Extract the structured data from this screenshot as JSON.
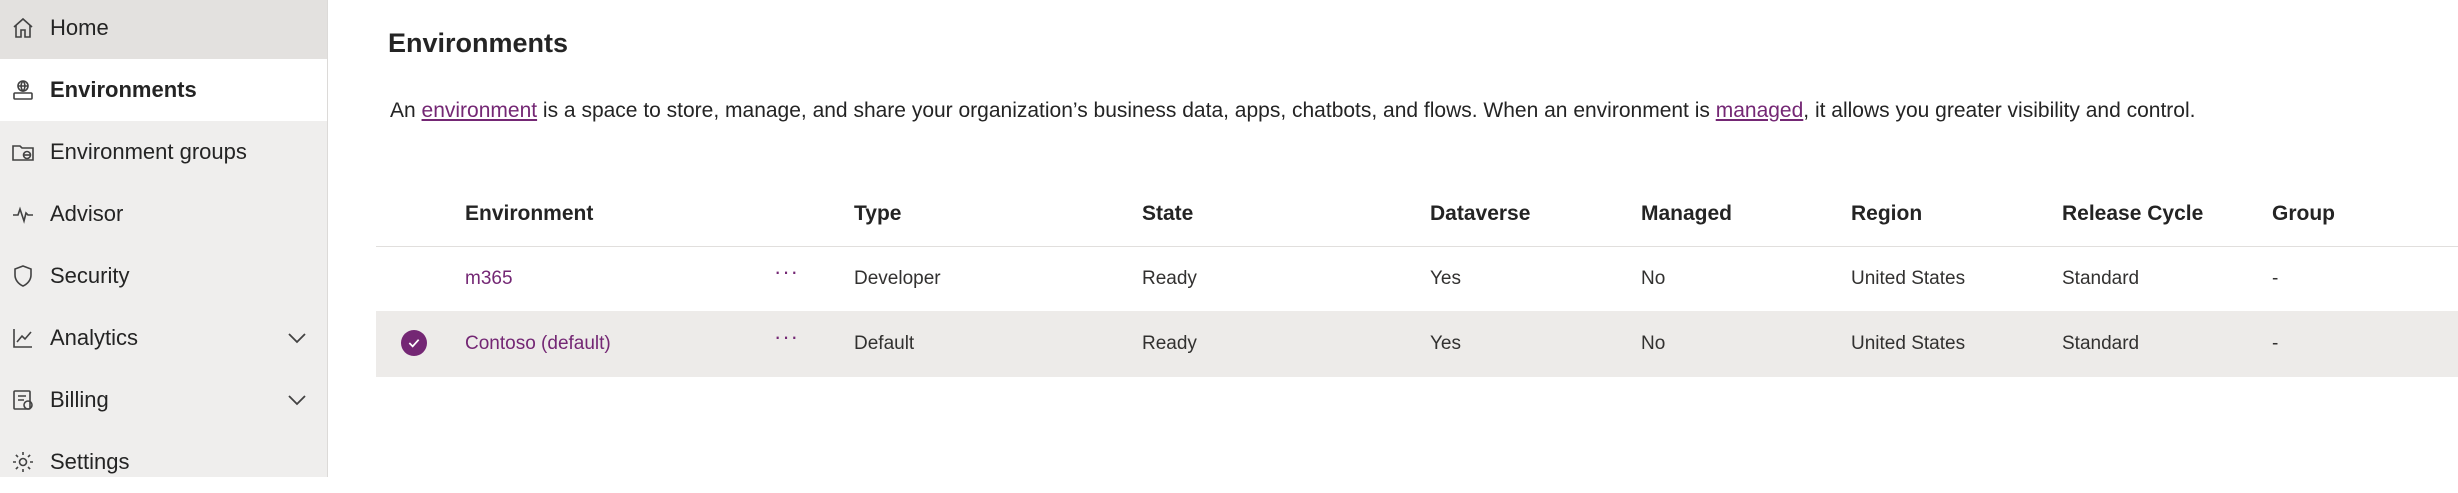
{
  "sidebar": {
    "items": [
      {
        "label": "Home",
        "icon": "home-icon"
      },
      {
        "label": "Environments",
        "icon": "environments-icon"
      },
      {
        "label": "Environment groups",
        "icon": "environment-groups-icon"
      },
      {
        "label": "Advisor",
        "icon": "pulse-icon"
      },
      {
        "label": "Security",
        "icon": "shield-icon"
      },
      {
        "label": "Analytics",
        "icon": "chart-icon"
      },
      {
        "label": "Billing",
        "icon": "billing-icon"
      },
      {
        "label": "Settings",
        "icon": "gear-icon"
      }
    ]
  },
  "main": {
    "title": "Environments",
    "description": {
      "part1": "An ",
      "link1": "environment",
      "part2": " is a space to store, manage, and share your organization’s business data, apps, chatbots, and flows. When an environment is ",
      "link2": "managed",
      "part3": ", it allows you greater visibility and control."
    }
  },
  "table": {
    "columns": [
      "Environment",
      "Type",
      "State",
      "Dataverse",
      "Managed",
      "Region",
      "Release Cycle",
      "Group"
    ],
    "rows": [
      {
        "name": "m365",
        "more": "···",
        "type": "Developer",
        "state": "Ready",
        "dataverse": "Yes",
        "managed": "No",
        "region": "United States",
        "release": "Standard",
        "group": "-",
        "selected": false
      },
      {
        "name": "Contoso (default)",
        "more": "···",
        "type": "Default",
        "state": "Ready",
        "dataverse": "Yes",
        "managed": "No",
        "region": "United States",
        "release": "Standard",
        "group": "-",
        "selected": true
      }
    ]
  },
  "colors": {
    "accent": "#742774",
    "sidebar_bg": "#efeeed",
    "selected_row": "#edebe9"
  }
}
